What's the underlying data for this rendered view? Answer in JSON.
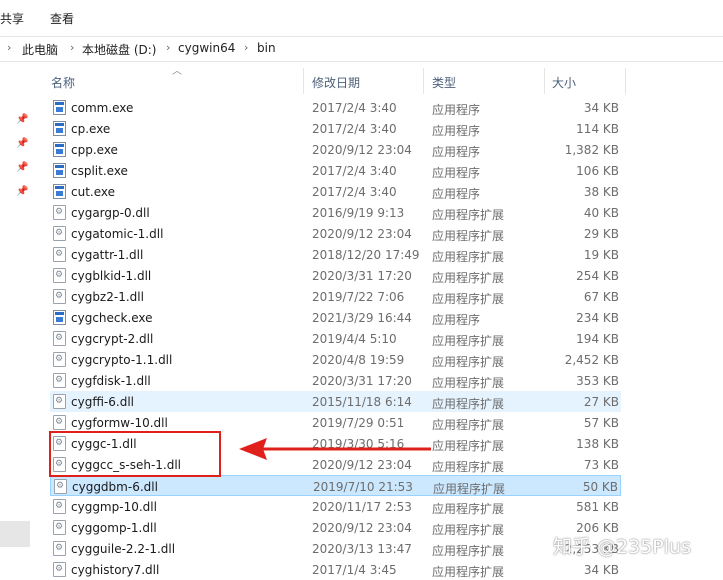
{
  "ribbon": {
    "share": "共享",
    "view": "查看"
  },
  "address": {
    "sep": "›",
    "crumbs": [
      "此电脑",
      "本地磁盘 (D:)",
      "cygwin64",
      "bin"
    ]
  },
  "columns": {
    "name": "名称",
    "date": "修改日期",
    "type": "类型",
    "size": "大小"
  },
  "files": [
    {
      "name": "comm.exe",
      "date": "2017/2/4 3:40",
      "type": "应用程序",
      "size": "34 KB",
      "icon": "exe-icon"
    },
    {
      "name": "cp.exe",
      "date": "2017/2/4 3:40",
      "type": "应用程序",
      "size": "114 KB",
      "icon": "exe-icon"
    },
    {
      "name": "cpp.exe",
      "date": "2020/9/12 23:04",
      "type": "应用程序",
      "size": "1,382 KB",
      "icon": "exe-icon"
    },
    {
      "name": "csplit.exe",
      "date": "2017/2/4 3:40",
      "type": "应用程序",
      "size": "106 KB",
      "icon": "exe-icon"
    },
    {
      "name": "cut.exe",
      "date": "2017/2/4 3:40",
      "type": "应用程序",
      "size": "38 KB",
      "icon": "exe-icon"
    },
    {
      "name": "cygargp-0.dll",
      "date": "2016/9/19 9:13",
      "type": "应用程序扩展",
      "size": "40 KB",
      "icon": "dll-icon"
    },
    {
      "name": "cygatomic-1.dll",
      "date": "2020/9/12 23:04",
      "type": "应用程序扩展",
      "size": "29 KB",
      "icon": "dll-icon"
    },
    {
      "name": "cygattr-1.dll",
      "date": "2018/12/20 17:49",
      "type": "应用程序扩展",
      "size": "19 KB",
      "icon": "dll-icon"
    },
    {
      "name": "cygblkid-1.dll",
      "date": "2020/3/31 17:20",
      "type": "应用程序扩展",
      "size": "254 KB",
      "icon": "dll-icon"
    },
    {
      "name": "cygbz2-1.dll",
      "date": "2019/7/22 7:06",
      "type": "应用程序扩展",
      "size": "67 KB",
      "icon": "dll-icon"
    },
    {
      "name": "cygcheck.exe",
      "date": "2021/3/29 16:44",
      "type": "应用程序",
      "size": "234 KB",
      "icon": "exe-icon"
    },
    {
      "name": "cygcrypt-2.dll",
      "date": "2019/4/4 5:10",
      "type": "应用程序扩展",
      "size": "194 KB",
      "icon": "dll-icon"
    },
    {
      "name": "cygcrypto-1.1.dll",
      "date": "2020/4/8 19:59",
      "type": "应用程序扩展",
      "size": "2,452 KB",
      "icon": "dll-icon"
    },
    {
      "name": "cygfdisk-1.dll",
      "date": "2020/3/31 17:20",
      "type": "应用程序扩展",
      "size": "353 KB",
      "icon": "dll-icon"
    },
    {
      "name": "cygffi-6.dll",
      "date": "2015/11/18 6:14",
      "type": "应用程序扩展",
      "size": "27 KB",
      "icon": "dll-icon",
      "state": "hover"
    },
    {
      "name": "cygformw-10.dll",
      "date": "2019/7/29 0:51",
      "type": "应用程序扩展",
      "size": "57 KB",
      "icon": "dll-icon"
    },
    {
      "name": "cyggc-1.dll",
      "date": "2019/3/30 5:16",
      "type": "应用程序扩展",
      "size": "138 KB",
      "icon": "dll-icon"
    },
    {
      "name": "cyggcc_s-seh-1.dll",
      "date": "2020/9/12 23:04",
      "type": "应用程序扩展",
      "size": "73 KB",
      "icon": "dll-icon"
    },
    {
      "name": "cyggdbm-6.dll",
      "date": "2019/7/10 21:53",
      "type": "应用程序扩展",
      "size": "50 KB",
      "icon": "dll-icon",
      "state": "sel"
    },
    {
      "name": "cyggmp-10.dll",
      "date": "2020/11/17 2:53",
      "type": "应用程序扩展",
      "size": "581 KB",
      "icon": "dll-icon"
    },
    {
      "name": "cyggomp-1.dll",
      "date": "2020/9/12 23:04",
      "type": "应用程序扩展",
      "size": "206 KB",
      "icon": "dll-icon"
    },
    {
      "name": "cygguile-2.2-1.dll",
      "date": "2020/3/13 13:47",
      "type": "应用程序扩展",
      "size": "2,253 KB",
      "icon": "dll-icon"
    },
    {
      "name": "cyghistory7.dll",
      "date": "2017/1/4 3:45",
      "type": "应用程序扩展",
      "size": "34 KB",
      "icon": "dll-icon"
    }
  ],
  "watermark": "知乎 @235Plus",
  "colors": {
    "annotation": "#e0201b",
    "hover": "#e5f3ff",
    "selected": "#cce8ff"
  }
}
